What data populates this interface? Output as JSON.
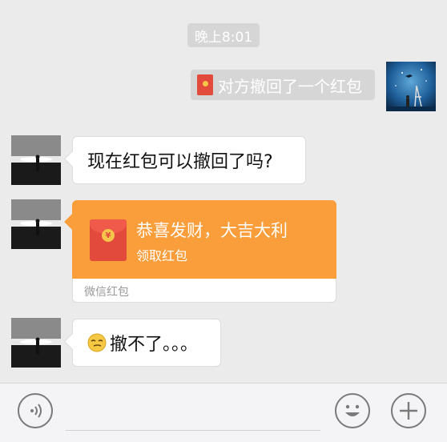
{
  "timestamp": "晚上8:01",
  "system_message": "对方撤回了一个红包",
  "messages": [
    {
      "text": "现在红包可以撤回了吗?"
    },
    {
      "text": "撤不了。。。"
    }
  ],
  "red_packet": {
    "title": "恭喜发财，大吉大利",
    "action": "领取红包",
    "footer": "微信红包",
    "coin_symbol": "¥"
  },
  "colors": {
    "background": "#ebebeb",
    "packet_orange": "#fa9d3b",
    "packet_red": "#e24a3b",
    "pill_gray": "#d6d6d6"
  },
  "toolbar": {
    "icons": [
      "voice-icon",
      "emoji-icon",
      "plus-icon"
    ]
  }
}
